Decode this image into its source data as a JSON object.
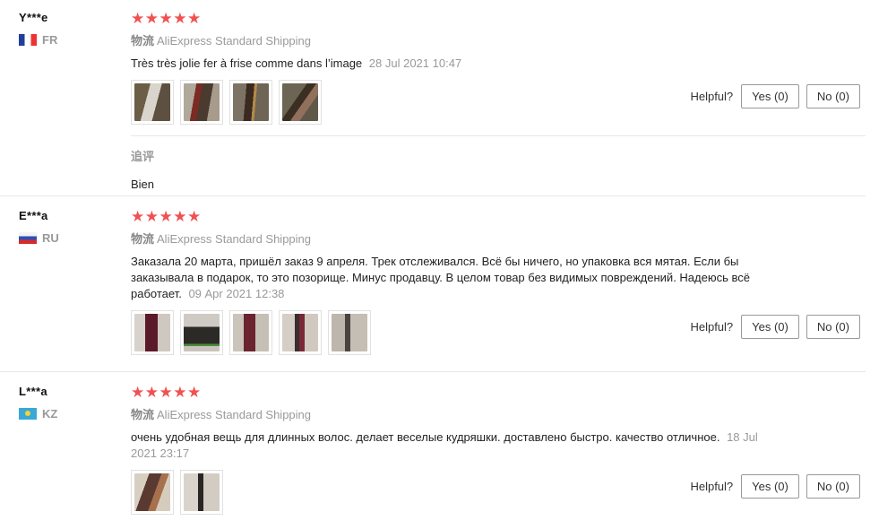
{
  "reviews": [
    {
      "user": "Y***e",
      "country": "FR",
      "stars": "★★★★★",
      "shipping_label": "物流",
      "shipping_method": "AliExpress Standard Shipping",
      "text": "Très très jolie fer à frise comme dans l’image",
      "date": "28 Jul 2021 10:47",
      "helpful_label": "Helpful?",
      "yes_label": "Yes (0)",
      "no_label": "No (0)",
      "followup_title": "追评",
      "followup_text": "Bien"
    },
    {
      "user": "E***a",
      "country": "RU",
      "stars": "★★★★★",
      "shipping_label": "物流",
      "shipping_method": "AliExpress Standard Shipping",
      "text": "Заказала 20 марта, пришёл заказ 9 апреля. Трек отслеживался. Всё бы ничего, но упаковка вся мятая. Если бы заказывала в подарок, то это позорище. Минус продавцу. В целом товар без видимых повреждений. Надеюсь всё работает.",
      "date": "09 Apr 2021 12:38",
      "helpful_label": "Helpful?",
      "yes_label": "Yes (0)",
      "no_label": "No (0)"
    },
    {
      "user": "L***a",
      "country": "KZ",
      "stars": "★★★★★",
      "shipping_label": "物流",
      "shipping_method": "AliExpress Standard Shipping",
      "text": "очень удобная вещь для длинных волос. делает веселые кудряшки. доставлено быстро. качество отличное.",
      "date": "18 Jul 2021 23:17",
      "helpful_label": "Helpful?",
      "yes_label": "Yes (0)",
      "no_label": "No (0)"
    }
  ]
}
